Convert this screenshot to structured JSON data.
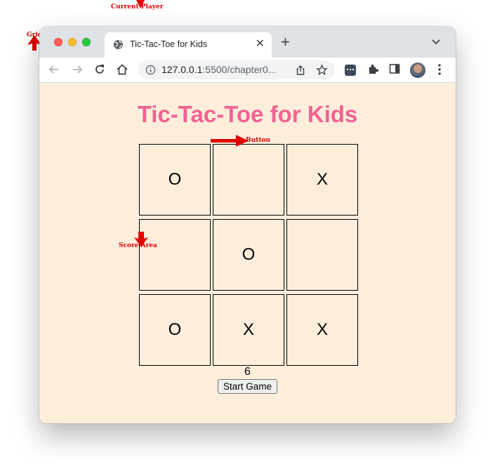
{
  "annotations": {
    "current_player": "Current Player",
    "grid": "Grid",
    "button": "Button",
    "score_area": "Score Area"
  },
  "browser": {
    "tab_title": "Tic-Tac-Toe for Kids",
    "url_host": "127.0.0.1",
    "url_rest": ":5500/chapter0..."
  },
  "page": {
    "title": "Tic-Tac-Toe for Kids",
    "cells": [
      "O",
      "",
      "X",
      "",
      "O",
      "",
      "O",
      "X",
      "X"
    ],
    "score": "6",
    "start_button": "Start Game"
  },
  "colors": {
    "title": "#f06292",
    "background": "#fdeedc",
    "annotation": "#e00000"
  },
  "icons": {
    "back": "back-arrow-icon",
    "forward": "forward-arrow-icon",
    "reload": "reload-icon",
    "home": "home-icon",
    "info": "info-icon",
    "share": "share-icon",
    "star": "star-icon",
    "extensions": "puzzle-icon",
    "sidepanel": "side-panel-icon",
    "menu": "kebab-menu-icon"
  }
}
